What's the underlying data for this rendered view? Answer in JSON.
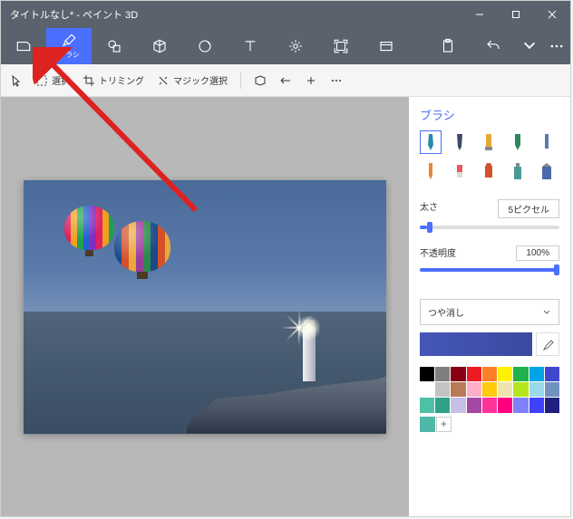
{
  "titlebar": {
    "title": "タイトルなし* - ペイント 3D"
  },
  "toolbar": {
    "brush_label": "ブラシ"
  },
  "secondary": {
    "select": "選択",
    "trimming": "トリミング",
    "magic_select": "マジック選択"
  },
  "panel": {
    "title": "ブラシ",
    "thickness_label": "太さ",
    "thickness_value": "5ピクセル",
    "thickness_pct": 5,
    "opacity_label": "不透明度",
    "opacity_value": "100%",
    "opacity_pct": 100,
    "finish_label": "つや消し",
    "palette": [
      "#000000",
      "#7f7f7f",
      "#880015",
      "#ed1c24",
      "#ff7f27",
      "#fff200",
      "#22b14c",
      "#00a2e8",
      "#3f48cc",
      "#ffffff",
      "#c3c3c3",
      "#b97a57",
      "#ffaec9",
      "#ffc90e",
      "#efe4b0",
      "#b5e61d",
      "#99d9ea",
      "#7092be",
      "#4ec0a5",
      "#30a088",
      "#c8bfe7",
      "#a349a4",
      "#ff3399",
      "#ff0080",
      "#8080ff",
      "#4040ff",
      "#202080"
    ],
    "user_colors": [
      "#4fb8a8"
    ],
    "current_color": "#4656b8"
  }
}
